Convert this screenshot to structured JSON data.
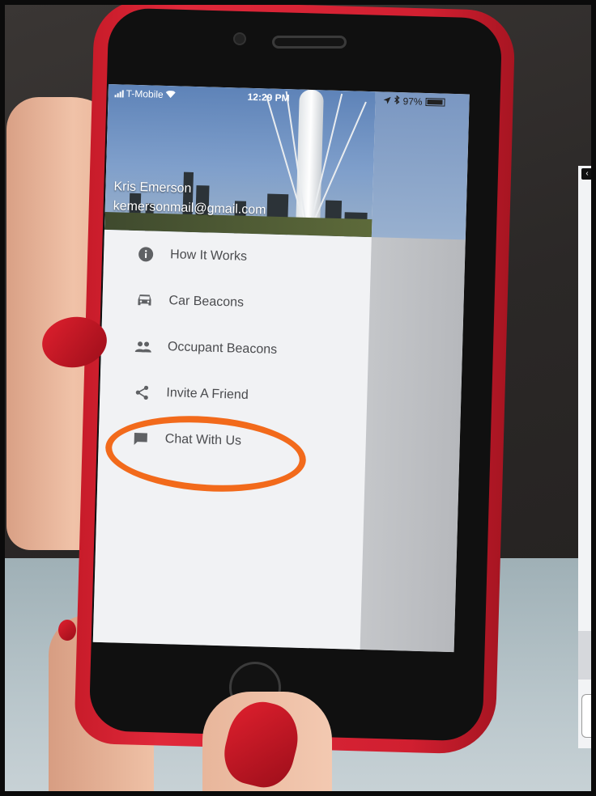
{
  "status_bar": {
    "carrier": "T-Mobile",
    "time": "12:29 PM",
    "battery": "97%",
    "icons": [
      "signal-icon",
      "wifi-icon",
      "location-icon",
      "bluetooth-icon",
      "battery-icon"
    ]
  },
  "profile": {
    "name": "Kris Emerson",
    "email": "kemersonmail@gmail.com"
  },
  "menu": {
    "items": [
      {
        "label": "How It Works",
        "icon": "info-icon"
      },
      {
        "label": "Car Beacons",
        "icon": "car-icon"
      },
      {
        "label": "Occupant Beacons",
        "icon": "people-icon"
      },
      {
        "label": "Invite A Friend",
        "icon": "share-icon"
      },
      {
        "label": "Chat With Us",
        "icon": "chat-icon"
      }
    ]
  },
  "annotation": {
    "color": "#f26a1b",
    "target": "Chat With Us"
  },
  "colors": {
    "phone_case": "#d01f30",
    "drawer_bg": "#f1f2f4",
    "menu_text": "#4a4b4e"
  }
}
